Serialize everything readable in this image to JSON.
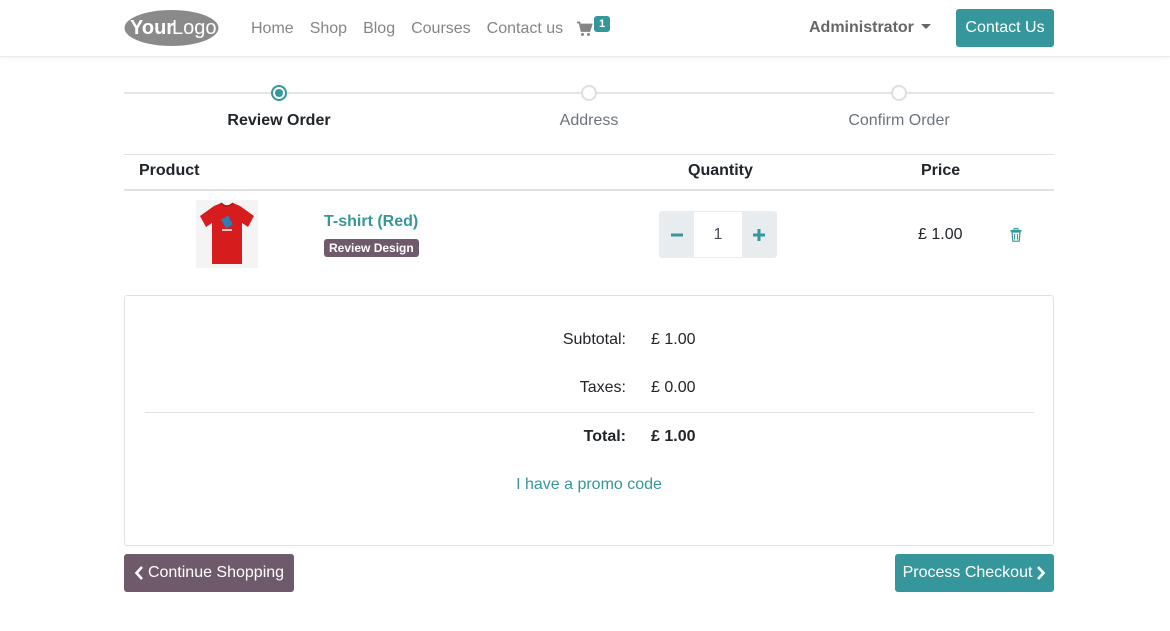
{
  "header": {
    "logo_text_your": "Your",
    "logo_text_logo": "Logo",
    "nav": [
      "Home",
      "Shop",
      "Blog",
      "Courses",
      "Contact us"
    ],
    "cart_count": "1",
    "cart_icon": "shopping-cart-icon",
    "user": "Administrator",
    "contact_button": "Contact Us"
  },
  "steps": {
    "items": [
      "Review Order",
      "Address",
      "Confirm Order"
    ],
    "active_index": 0
  },
  "table": {
    "headers": {
      "product": "Product",
      "quantity": "Quantity",
      "price": "Price"
    },
    "rows": [
      {
        "name": "T-shirt (Red)",
        "badge": "Review Design",
        "quantity": "1",
        "price": "£ 1.00",
        "image_icon": "red-tshirt-image",
        "delete_icon": "trash-icon"
      }
    ]
  },
  "summary": {
    "subtotal_label": "Subtotal:",
    "subtotal_value": "£ 1.00",
    "taxes_label": "Taxes:",
    "taxes_value": "£ 0.00",
    "total_label": "Total:",
    "total_value": "£ 1.00",
    "promo": "I have a promo code"
  },
  "actions": {
    "continue": "Continue Shopping",
    "checkout": "Process Checkout"
  },
  "colors": {
    "primary": "#35979c",
    "secondary": "#6f5a6b",
    "product_red": "#d61c1c"
  }
}
